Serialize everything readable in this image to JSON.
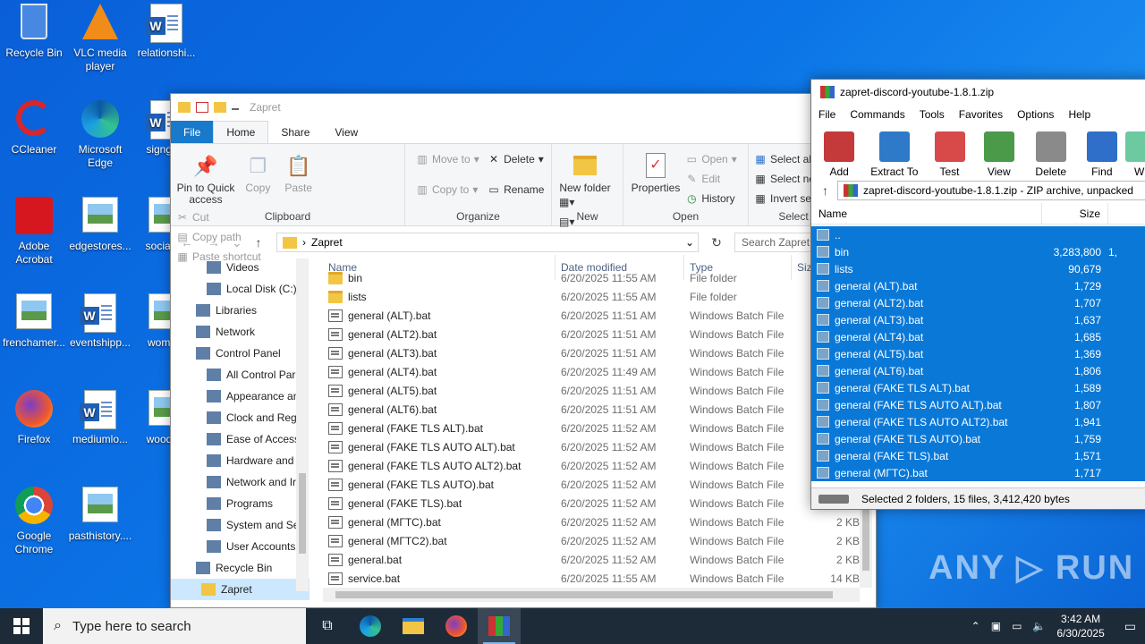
{
  "desktop": {
    "icons": [
      {
        "label": "Recycle Bin"
      },
      {
        "label": "VLC media player"
      },
      {
        "label": "relationshi..."
      },
      {
        "label": "CCleaner"
      },
      {
        "label": "Microsoft Edge"
      },
      {
        "label": "signgo..."
      },
      {
        "label": "Adobe Acrobat"
      },
      {
        "label": "edgestores..."
      },
      {
        "label": "socialc..."
      },
      {
        "label": "frenchamer..."
      },
      {
        "label": "eventshipp..."
      },
      {
        "label": "wome..."
      },
      {
        "label": "Firefox"
      },
      {
        "label": "mediumlo..."
      },
      {
        "label": "woodc..."
      },
      {
        "label": "Google Chrome"
      },
      {
        "label": "pasthistory...."
      }
    ]
  },
  "explorer": {
    "title": "Zapret",
    "tabs": [
      "File",
      "Home",
      "Share",
      "View"
    ],
    "clipboard": {
      "pin": "Pin to Quick access",
      "copy": "Copy",
      "paste": "Paste",
      "cut": "Cut",
      "copy_path": "Copy path",
      "paste_shortcut": "Paste shortcut",
      "label": "Clipboard"
    },
    "organize": {
      "move_to": "Move to",
      "copy_to": "Copy to",
      "delete": "Delete",
      "rename": "Rename",
      "label": "Organize"
    },
    "new": {
      "new_folder": "New folder",
      "label": "New"
    },
    "open": {
      "properties": "Properties",
      "open": "Open",
      "edit": "Edit",
      "history": "History",
      "label": "Open"
    },
    "select": {
      "select_all": "Select all",
      "select_none": "Select no",
      "invert": "Invert sel",
      "label": "Select"
    },
    "address": {
      "crumb": "Zapret",
      "search_placeholder": "Search Zapret"
    },
    "nav": [
      {
        "label": "Videos"
      },
      {
        "label": "Local Disk (C:)"
      },
      {
        "label": "Libraries"
      },
      {
        "label": "Network"
      },
      {
        "label": "Control Panel"
      },
      {
        "label": "All Control Par"
      },
      {
        "label": "Appearance an"
      },
      {
        "label": "Clock and Regi"
      },
      {
        "label": "Ease of Access"
      },
      {
        "label": "Hardware and"
      },
      {
        "label": "Network and Ir"
      },
      {
        "label": "Programs"
      },
      {
        "label": "System and Se"
      },
      {
        "label": "User Accounts"
      },
      {
        "label": "Recycle Bin"
      },
      {
        "label": "Zapret"
      }
    ],
    "columns": {
      "name": "Name",
      "date": "Date modified",
      "type": "Type",
      "size": "Siz"
    },
    "files": [
      {
        "name": "bin",
        "date": "6/20/2025 11:55 AM",
        "type": "File folder",
        "size": "",
        "kind": "folder"
      },
      {
        "name": "lists",
        "date": "6/20/2025 11:55 AM",
        "type": "File folder",
        "size": "",
        "kind": "folder"
      },
      {
        "name": "general (ALT).bat",
        "date": "6/20/2025 11:51 AM",
        "type": "Windows Batch File",
        "size": "",
        "kind": "bat"
      },
      {
        "name": "general (ALT2).bat",
        "date": "6/20/2025 11:51 AM",
        "type": "Windows Batch File",
        "size": "",
        "kind": "bat"
      },
      {
        "name": "general (ALT3).bat",
        "date": "6/20/2025 11:51 AM",
        "type": "Windows Batch File",
        "size": "",
        "kind": "bat"
      },
      {
        "name": "general (ALT4).bat",
        "date": "6/20/2025 11:49 AM",
        "type": "Windows Batch File",
        "size": "",
        "kind": "bat"
      },
      {
        "name": "general (ALT5).bat",
        "date": "6/20/2025 11:51 AM",
        "type": "Windows Batch File",
        "size": "",
        "kind": "bat"
      },
      {
        "name": "general (ALT6).bat",
        "date": "6/20/2025 11:51 AM",
        "type": "Windows Batch File",
        "size": "",
        "kind": "bat"
      },
      {
        "name": "general (FAKE TLS ALT).bat",
        "date": "6/20/2025 11:52 AM",
        "type": "Windows Batch File",
        "size": "",
        "kind": "bat"
      },
      {
        "name": "general (FAKE TLS AUTO ALT).bat",
        "date": "6/20/2025 11:52 AM",
        "type": "Windows Batch File",
        "size": "",
        "kind": "bat"
      },
      {
        "name": "general (FAKE TLS AUTO ALT2).bat",
        "date": "6/20/2025 11:52 AM",
        "type": "Windows Batch File",
        "size": "",
        "kind": "bat"
      },
      {
        "name": "general (FAKE TLS AUTO).bat",
        "date": "6/20/2025 11:52 AM",
        "type": "Windows Batch File",
        "size": "",
        "kind": "bat"
      },
      {
        "name": "general (FAKE TLS).bat",
        "date": "6/20/2025 11:52 AM",
        "type": "Windows Batch File",
        "size": "",
        "kind": "bat"
      },
      {
        "name": "general (МГТС).bat",
        "date": "6/20/2025 11:52 AM",
        "type": "Windows Batch File",
        "size": "2 KB",
        "kind": "bat"
      },
      {
        "name": "general (МГТС2).bat",
        "date": "6/20/2025 11:52 AM",
        "type": "Windows Batch File",
        "size": "2 KB",
        "kind": "bat"
      },
      {
        "name": "general.bat",
        "date": "6/20/2025 11:52 AM",
        "type": "Windows Batch File",
        "size": "2 KB",
        "kind": "bat"
      },
      {
        "name": "service.bat",
        "date": "6/20/2025 11:55 AM",
        "type": "Windows Batch File",
        "size": "14 KB",
        "kind": "bat"
      }
    ]
  },
  "winrar": {
    "title": "zapret-discord-youtube-1.8.1.zip",
    "menu": [
      "File",
      "Commands",
      "Tools",
      "Favorites",
      "Options",
      "Help"
    ],
    "toolbar": [
      "Add",
      "Extract To",
      "Test",
      "View",
      "Delete",
      "Find",
      "Wi"
    ],
    "path": "zapret-discord-youtube-1.8.1.zip - ZIP archive, unpacked",
    "columns": {
      "name": "Name",
      "size": "Size"
    },
    "rows": [
      {
        "name": "..",
        "size": "",
        "extra": ""
      },
      {
        "name": "bin",
        "size": "3,283,800",
        "extra": "1,"
      },
      {
        "name": "lists",
        "size": "90,679",
        "extra": ""
      },
      {
        "name": "general (ALT).bat",
        "size": "1,729",
        "extra": ""
      },
      {
        "name": "general (ALT2).bat",
        "size": "1,707",
        "extra": ""
      },
      {
        "name": "general (ALT3).bat",
        "size": "1,637",
        "extra": ""
      },
      {
        "name": "general (ALT4).bat",
        "size": "1,685",
        "extra": ""
      },
      {
        "name": "general (ALT5).bat",
        "size": "1,369",
        "extra": ""
      },
      {
        "name": "general (ALT6).bat",
        "size": "1,806",
        "extra": ""
      },
      {
        "name": "general (FAKE TLS ALT).bat",
        "size": "1,589",
        "extra": ""
      },
      {
        "name": "general (FAKE TLS AUTO ALT).bat",
        "size": "1,807",
        "extra": ""
      },
      {
        "name": "general (FAKE TLS AUTO ALT2).bat",
        "size": "1,941",
        "extra": ""
      },
      {
        "name": "general (FAKE TLS AUTO).bat",
        "size": "1,759",
        "extra": ""
      },
      {
        "name": "general (FAKE TLS).bat",
        "size": "1,571",
        "extra": ""
      },
      {
        "name": "general (МГТС).bat",
        "size": "1,717",
        "extra": ""
      }
    ],
    "status": "Selected 2 folders, 15 files, 3,412,420 bytes"
  },
  "taskbar": {
    "search_placeholder": "Type here to search",
    "time": "3:42 AM",
    "date": "6/30/2025"
  },
  "watermark": "ANY ▷ RUN"
}
